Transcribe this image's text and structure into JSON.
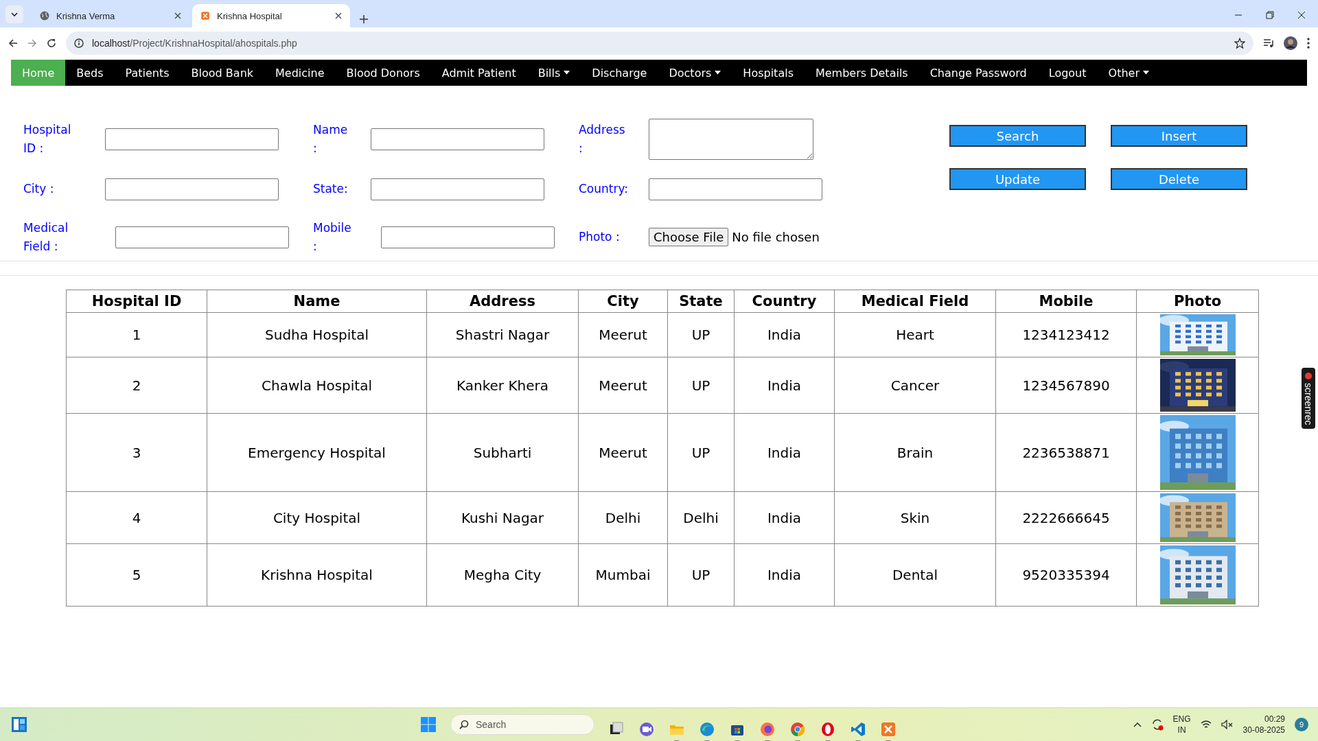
{
  "browser": {
    "tabs": [
      {
        "title": "Krishna Verma",
        "selected": false
      },
      {
        "title": "Krishna Hospital",
        "selected": true
      }
    ],
    "url_host": "localhost",
    "url_path": "/Project/KrishnaHospital/ahospitals.php"
  },
  "nav": [
    {
      "label": "Home",
      "selected": true,
      "has_menu": false
    },
    {
      "label": "Beds",
      "selected": false,
      "has_menu": false
    },
    {
      "label": "Patients",
      "selected": false,
      "has_menu": false
    },
    {
      "label": "Blood Bank",
      "selected": false,
      "has_menu": false
    },
    {
      "label": "Medicine",
      "selected": false,
      "has_menu": false
    },
    {
      "label": "Blood Donors",
      "selected": false,
      "has_menu": false
    },
    {
      "label": "Admit Patient",
      "selected": false,
      "has_menu": false
    },
    {
      "label": "Bills",
      "selected": false,
      "has_menu": true
    },
    {
      "label": "Discharge",
      "selected": false,
      "has_menu": false
    },
    {
      "label": "Doctors",
      "selected": false,
      "has_menu": true
    },
    {
      "label": "Hospitals",
      "selected": false,
      "has_menu": false
    },
    {
      "label": "Members Details",
      "selected": false,
      "has_menu": false
    },
    {
      "label": "Change Password",
      "selected": false,
      "has_menu": false
    },
    {
      "label": "Logout",
      "selected": false,
      "has_menu": false
    },
    {
      "label": "Other",
      "selected": false,
      "has_menu": true
    }
  ],
  "form": {
    "fields": [
      {
        "label": "Hospital ID :",
        "kind": "text"
      },
      {
        "label": "Name :",
        "kind": "text"
      },
      {
        "label": "Address :",
        "kind": "textarea"
      },
      {
        "label": "City :",
        "kind": "text"
      },
      {
        "label": "State:",
        "kind": "text"
      },
      {
        "label": "Country:",
        "kind": "text"
      },
      {
        "label": "Medical Field :",
        "kind": "text"
      },
      {
        "label": "Mobile :",
        "kind": "text"
      },
      {
        "label": "Photo :",
        "kind": "file",
        "button": "Choose File",
        "status": "No file chosen"
      }
    ],
    "buttons": [
      "Search",
      "Insert",
      "Update",
      "Delete"
    ]
  },
  "table": {
    "columns": [
      "Hospital ID",
      "Name",
      "Address",
      "City",
      "State",
      "Country",
      "Medical Field",
      "Mobile",
      "Photo"
    ],
    "rows": [
      {
        "cells": [
          "1",
          "Sudha Hospital",
          "Shastri Nagar",
          "Meerut",
          "UP",
          "India",
          "Heart",
          "1234123412"
        ],
        "photo": {
          "kind": "picture"
        }
      },
      {
        "cells": [
          "2",
          "Chawla Hospital",
          "Kanker Khera",
          "Meerut",
          "UP",
          "India",
          "Cancer",
          "1234567890"
        ],
        "photo": {
          "kind": "picture"
        }
      },
      {
        "cells": [
          "3",
          "Emergency Hospital",
          "Subharti",
          "Meerut",
          "UP",
          "India",
          "Brain",
          "2236538871"
        ],
        "photo": {
          "kind": "picture"
        }
      },
      {
        "cells": [
          "4",
          "City Hospital",
          "Kushi Nagar",
          "Delhi",
          "Delhi",
          "India",
          "Skin",
          "2222666645"
        ],
        "photo": {
          "kind": "picture"
        }
      },
      {
        "cells": [
          "5",
          "Krishna Hospital",
          "Megha City",
          "Mumbai",
          "UP",
          "India",
          "Dental",
          "9520335394"
        ],
        "photo": {
          "kind": "picture"
        }
      }
    ]
  },
  "recorder": {
    "label": "screenrec"
  },
  "taskbar": {
    "search_placeholder": "Search",
    "apps": [
      {
        "kind": "files",
        "active": false
      },
      {
        "kind": "meet",
        "active": false
      },
      {
        "kind": "folder",
        "active": true
      },
      {
        "kind": "edge",
        "active": true
      },
      {
        "kind": "store",
        "active": true
      },
      {
        "kind": "firefox",
        "active": true
      },
      {
        "kind": "chrome",
        "active": true
      },
      {
        "kind": "opera",
        "active": true
      },
      {
        "kind": "vscode",
        "active": true
      },
      {
        "kind": "xampp",
        "active": true
      }
    ],
    "language": "ENG",
    "region": "IN",
    "time": "00:29",
    "date": "30-08-2025",
    "notifications": "9"
  }
}
